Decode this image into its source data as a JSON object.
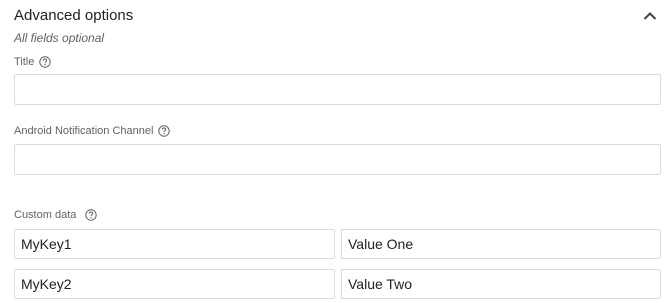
{
  "section": {
    "title": "Advanced options",
    "subtitle": "All fields optional",
    "collapse_icon": "chevron-up-icon"
  },
  "fields": {
    "title": {
      "label": "Title",
      "value": "",
      "help_icon": "help-circle-icon"
    },
    "channel": {
      "label": "Android Notification Channel",
      "value": "",
      "help_icon": "help-circle-icon"
    }
  },
  "custom_data": {
    "label": "Custom data",
    "help_icon": "help-circle-icon",
    "rows": [
      {
        "key": "MyKey1",
        "value": "Value One"
      },
      {
        "key": "MyKey2",
        "value": "Value Two"
      }
    ]
  }
}
